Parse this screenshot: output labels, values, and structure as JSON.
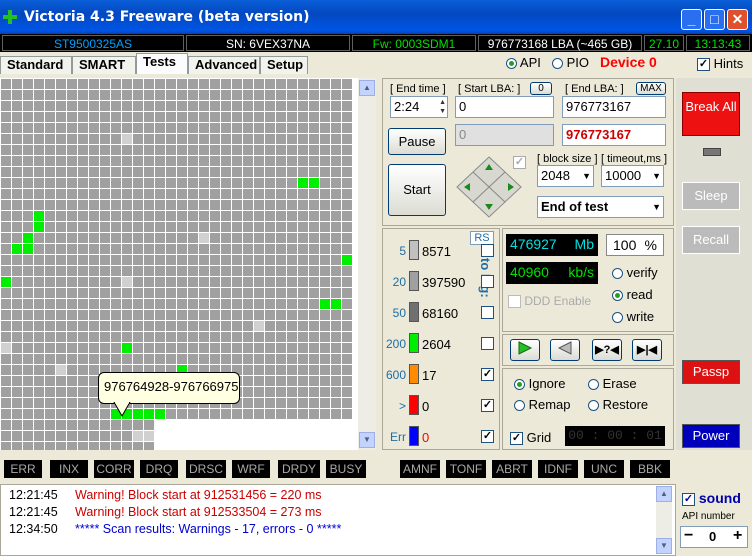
{
  "window": {
    "title": "Victoria 4.3 Freeware (beta version)"
  },
  "infobar": {
    "model": "ST9500325AS",
    "serial": "SN: 6VEX37NA",
    "firmware": "Fw: 0003SDM1",
    "lba": "976773168 LBA (~465 GB)",
    "date": "27.10",
    "time": "13:13:43"
  },
  "tabs": [
    "Standard",
    "SMART",
    "Tests",
    "Advanced",
    "Setup"
  ],
  "mode": {
    "api_label": "API",
    "pio_label": "PIO",
    "selected": "API",
    "device_label": "Device 0",
    "hints_label": "Hints",
    "hints_checked": true
  },
  "scan": {
    "end_time_label": "[ End time ]",
    "end_time_value": "2:24",
    "start_lba_label": "[ Start LBA: ]",
    "start_lba_btn": "0",
    "start_lba_value": "0",
    "end_lba_label": "[ End LBA: ]",
    "end_lba_btn": "MAX",
    "end_lba_value": "976773167",
    "current_lba_value": "976773167",
    "pause_label": "Pause",
    "start_label": "Start",
    "block_size_label": "[ block size ]",
    "block_size_value": "2048",
    "timeout_label": "[ timeout,ms ]",
    "timeout_value": "10000",
    "end_action_value": "End of test"
  },
  "timings": {
    "rs_label": "RS",
    "to_log_label": "to log:",
    "rows": [
      {
        "threshold": "5",
        "count": "8571",
        "color": "#c0c0c0",
        "logged": false
      },
      {
        "threshold": "20",
        "count": "397590",
        "color": "#a0a0a0",
        "logged": false
      },
      {
        "threshold": "50",
        "count": "68160",
        "color": "#707070",
        "logged": false
      },
      {
        "threshold": "200",
        "count": "2604",
        "color": "#00ee00",
        "logged": false
      },
      {
        "threshold": "600",
        "count": "17",
        "color": "#ff8c00",
        "logged": true
      },
      {
        "threshold": ">",
        "count": "0",
        "color": "#ff0000",
        "logged": true
      },
      {
        "threshold": "Err",
        "count": "0",
        "color": "#0000ff",
        "logged": true
      }
    ]
  },
  "speed": {
    "mb_value": "476927",
    "mb_unit": "Mb",
    "percent_value": "100",
    "percent_unit": "%",
    "kbs_value": "40960",
    "kbs_unit": "kb/s",
    "ddd_label": "DDD Enable"
  },
  "test_mode": {
    "options": [
      "verify",
      "read",
      "write"
    ],
    "selected": "read"
  },
  "actions": {
    "options": [
      "Ignore",
      "Erase",
      "Remap",
      "Restore"
    ],
    "selected": "Ignore",
    "grid_label": "Grid",
    "grid_checked": true,
    "timer": "00 : 00 : 01"
  },
  "right_buttons": {
    "break_all": "Break All",
    "sleep": "Sleep",
    "recall": "Recall",
    "passp": "Passp",
    "power": "Power"
  },
  "status_flags": [
    "ERR",
    "INX",
    "CORR",
    "DRQ",
    "DRSC",
    "WRF",
    "DRDY",
    "BUSY",
    "AMNF",
    "TONF",
    "ABRT",
    "IDNF",
    "UNC",
    "BBK"
  ],
  "tooltip": "976764928-976766975",
  "log": [
    {
      "time": "12:21:45",
      "message": "Warning! Block start at 912531456 = 220 ms",
      "color": "#cc0000"
    },
    {
      "time": "12:21:45",
      "message": "Warning! Block start at 912533504 = 273 ms",
      "color": "#cc0000"
    },
    {
      "time": "12:34:50",
      "message": "***** Scan results: Warnings - 17, errors - 0 *****",
      "color": "#0000cc"
    }
  ],
  "sound": {
    "label": "sound",
    "checked": true,
    "api_number_label": "API number",
    "api_number_value": "0"
  },
  "colors": {
    "title_bar": "#0348c0",
    "accent_red": "#ff0000",
    "block_green": "#00ee00",
    "block_gray": "#a0a0a0"
  }
}
